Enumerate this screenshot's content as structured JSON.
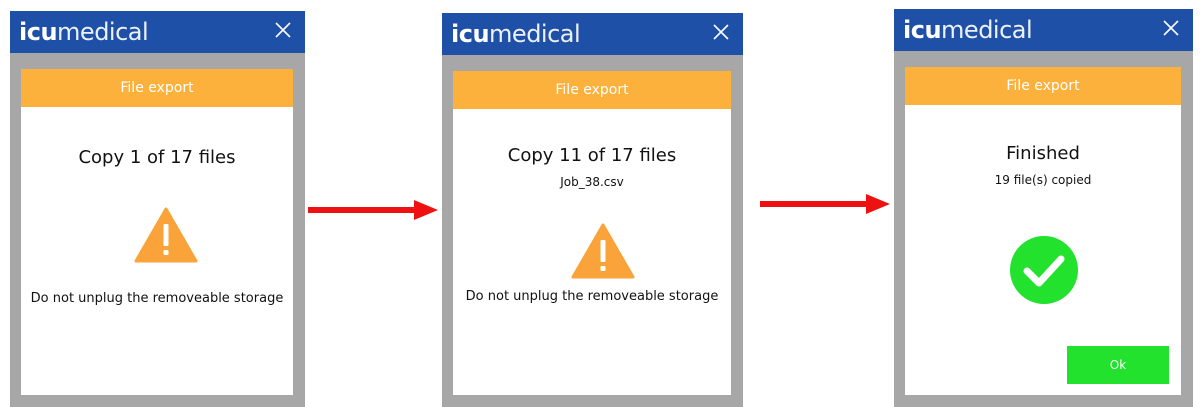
{
  "brand": {
    "bold": "icu",
    "light": "medical"
  },
  "screens": [
    {
      "header": "File export",
      "title": "Copy 1 of 17 files",
      "subtitle": "",
      "message": "Do not unplug the removeable storage",
      "icon": "warning-icon"
    },
    {
      "header": "File export",
      "title": "Copy 11 of 17 files",
      "subtitle": "Job_38.csv",
      "message": "Do not unplug the removeable storage",
      "icon": "warning-icon"
    },
    {
      "header": "File export",
      "title": "Finished",
      "subtitle": "19 file(s) copied",
      "icon": "checkmark-icon",
      "button": "Ok"
    }
  ],
  "colors": {
    "topbar": "#1d50a6",
    "header": "#fbb13c",
    "warning": "#f9a33a",
    "success": "#22e22d",
    "arrow": "#ee1111"
  }
}
